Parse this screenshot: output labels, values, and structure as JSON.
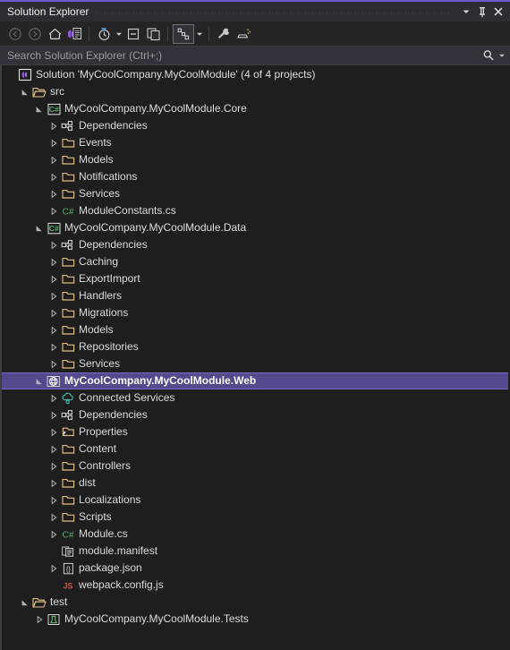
{
  "window": {
    "title": "Solution Explorer",
    "accent_color": "#6a5acd",
    "background": "#1e1e1e",
    "selection_color": "#54488f",
    "buttons": [
      {
        "name": "window-menu-dropdown",
        "icon": "chevron-down-icon",
        "glyph": "▼"
      },
      {
        "name": "pin-window-button",
        "icon": "pin-icon",
        "glyph": "⚐"
      },
      {
        "name": "close-window-button",
        "icon": "close-icon",
        "glyph": "✕"
      }
    ]
  },
  "toolbar": {
    "items": [
      {
        "name": "navigate-back-button",
        "icon": "arrow-left-circle-icon",
        "label": "Back",
        "disabled": true
      },
      {
        "name": "navigate-forward-button",
        "icon": "arrow-right-circle-icon",
        "label": "Forward",
        "disabled": true
      },
      {
        "name": "home-button",
        "icon": "home-icon",
        "label": "Home",
        "disabled": false
      },
      {
        "name": "properties-window-button",
        "icon": "vs-properties-icon",
        "label": "Properties Window",
        "disabled": false
      },
      {
        "name": "pending-changes-button",
        "icon": "clock-filter-icon",
        "label": "Pending Changes Filter",
        "disabled": false,
        "has_caret": true
      },
      {
        "name": "collapse-all-button",
        "icon": "collapse-all-icon",
        "label": "Collapse All",
        "disabled": false
      },
      {
        "name": "new-solution-view-button",
        "icon": "copy-windows-icon",
        "label": "New Solution Explorer View",
        "disabled": false
      },
      {
        "name": "show-all-files-button",
        "icon": "show-all-files-icon",
        "label": "Show All Files",
        "disabled": false,
        "active": true,
        "has_caret": true
      },
      {
        "name": "properties-button",
        "icon": "wrench-icon",
        "label": "Properties",
        "disabled": false
      },
      {
        "name": "preview-selected-items-button",
        "icon": "preview-icon",
        "label": "Preview Selected Items",
        "disabled": false
      }
    ]
  },
  "search": {
    "placeholder": "Search Solution Explorer (Ctrl+;)",
    "value": "",
    "icon": "search-icon",
    "dropdown_icon": "chevron-down-icon"
  },
  "tree": {
    "rows": [
      {
        "label": "Solution 'MyCoolCompany.MyCoolModule' (4 of 4 projects)",
        "icon": "solution-icon",
        "indent": 0,
        "expander": "none",
        "selected": false
      },
      {
        "label": "src",
        "icon": "folder-open-icon",
        "indent": 1,
        "expander": "expanded",
        "selected": false
      },
      {
        "label": "MyCoolCompany.MyCoolModule.Core",
        "icon": "csharp-project-icon",
        "indent": 2,
        "expander": "expanded",
        "selected": false
      },
      {
        "label": "Dependencies",
        "icon": "dependencies-icon",
        "indent": 3,
        "expander": "collapsed",
        "selected": false
      },
      {
        "label": "Events",
        "icon": "folder-icon",
        "indent": 3,
        "expander": "collapsed",
        "selected": false
      },
      {
        "label": "Models",
        "icon": "folder-icon",
        "indent": 3,
        "expander": "collapsed",
        "selected": false
      },
      {
        "label": "Notifications",
        "icon": "folder-icon",
        "indent": 3,
        "expander": "collapsed",
        "selected": false
      },
      {
        "label": "Services",
        "icon": "folder-icon",
        "indent": 3,
        "expander": "collapsed",
        "selected": false
      },
      {
        "label": "ModuleConstants.cs",
        "icon": "csharp-file-icon",
        "indent": 3,
        "expander": "collapsed",
        "selected": false
      },
      {
        "label": "MyCoolCompany.MyCoolModule.Data",
        "icon": "csharp-project-icon",
        "indent": 2,
        "expander": "expanded",
        "selected": false
      },
      {
        "label": "Dependencies",
        "icon": "dependencies-icon",
        "indent": 3,
        "expander": "collapsed",
        "selected": false
      },
      {
        "label": "Caching",
        "icon": "folder-icon",
        "indent": 3,
        "expander": "collapsed",
        "selected": false
      },
      {
        "label": "ExportImport",
        "icon": "folder-icon",
        "indent": 3,
        "expander": "collapsed",
        "selected": false
      },
      {
        "label": "Handlers",
        "icon": "folder-icon",
        "indent": 3,
        "expander": "collapsed",
        "selected": false
      },
      {
        "label": "Migrations",
        "icon": "folder-icon",
        "indent": 3,
        "expander": "collapsed",
        "selected": false
      },
      {
        "label": "Models",
        "icon": "folder-icon",
        "indent": 3,
        "expander": "collapsed",
        "selected": false
      },
      {
        "label": "Repositories",
        "icon": "folder-icon",
        "indent": 3,
        "expander": "collapsed",
        "selected": false
      },
      {
        "label": "Services",
        "icon": "folder-icon",
        "indent": 3,
        "expander": "collapsed",
        "selected": false
      },
      {
        "label": "MyCoolCompany.MyCoolModule.Web",
        "icon": "web-project-icon",
        "indent": 2,
        "expander": "expanded",
        "selected": true
      },
      {
        "label": "Connected Services",
        "icon": "connected-services-icon",
        "indent": 3,
        "expander": "collapsed",
        "selected": false
      },
      {
        "label": "Dependencies",
        "icon": "dependencies-icon",
        "indent": 3,
        "expander": "collapsed",
        "selected": false
      },
      {
        "label": "Properties",
        "icon": "properties-folder-icon",
        "indent": 3,
        "expander": "collapsed",
        "selected": false
      },
      {
        "label": "Content",
        "icon": "folder-icon",
        "indent": 3,
        "expander": "collapsed",
        "selected": false
      },
      {
        "label": "Controllers",
        "icon": "folder-icon",
        "indent": 3,
        "expander": "collapsed",
        "selected": false
      },
      {
        "label": "dist",
        "icon": "folder-icon",
        "indent": 3,
        "expander": "collapsed",
        "selected": false
      },
      {
        "label": "Localizations",
        "icon": "folder-icon",
        "indent": 3,
        "expander": "collapsed",
        "selected": false
      },
      {
        "label": "Scripts",
        "icon": "folder-icon",
        "indent": 3,
        "expander": "collapsed",
        "selected": false
      },
      {
        "label": "Module.cs",
        "icon": "csharp-file-icon",
        "indent": 3,
        "expander": "collapsed",
        "selected": false
      },
      {
        "label": "module.manifest",
        "icon": "manifest-file-icon",
        "indent": 3,
        "expander": "none",
        "selected": false
      },
      {
        "label": "package.json",
        "icon": "json-file-icon",
        "indent": 3,
        "expander": "collapsed",
        "selected": false
      },
      {
        "label": "webpack.config.js",
        "icon": "js-file-icon",
        "indent": 3,
        "expander": "none",
        "selected": false
      },
      {
        "label": "test",
        "icon": "folder-open-icon",
        "indent": 1,
        "expander": "expanded",
        "selected": false
      },
      {
        "label": "MyCoolCompany.MyCoolModule.Tests",
        "icon": "test-project-icon",
        "indent": 2,
        "expander": "collapsed",
        "selected": false
      }
    ]
  }
}
